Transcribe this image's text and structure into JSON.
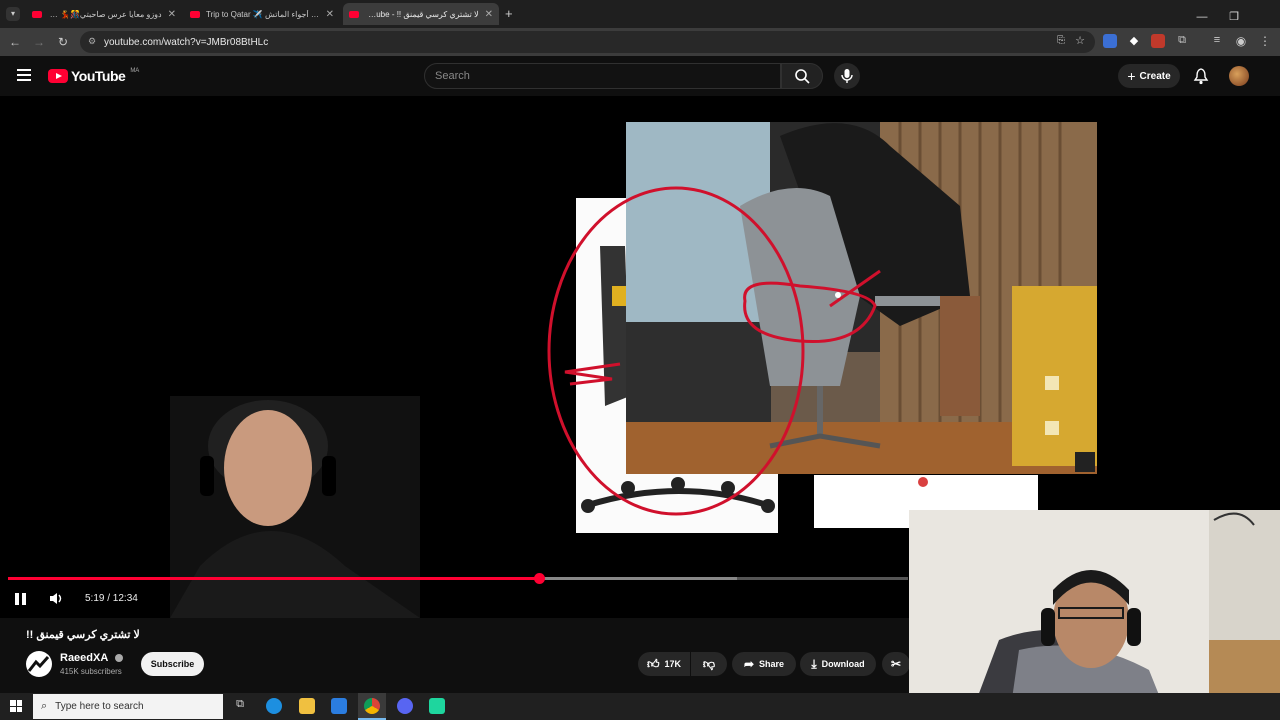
{
  "browser": {
    "tabs": [
      {
        "title": "دوزو معايا عرس صاحبتي🎊💃 جيب..."
      },
      {
        "title": "Trip to Qatar ✈️ أجواء الماتش 🇶🇦"
      },
      {
        "title": "لا تشتري كرسي قيمنق !! - YouTube"
      }
    ],
    "url": "youtube.com/watch?v=JMBr08BtHLc"
  },
  "youtube": {
    "logo_text": "YouTube",
    "region": "MA",
    "search_placeholder": "Search",
    "create_label": "Create"
  },
  "player": {
    "time_display": "5:19 / 12:34",
    "progress": 0.59,
    "buffered": 0.81
  },
  "video": {
    "title": "لا تشتري كرسي قيمنق !!",
    "channel": "RaeedXA",
    "subscribers": "415K subscribers",
    "subscribe_label": "Subscribe",
    "likes": "17K",
    "share_label": "Share",
    "download_label": "Download"
  },
  "taskbar": {
    "search_placeholder": "Type here to search"
  },
  "colors": {
    "accent": "#ff0033",
    "background": "#0f0f0f"
  }
}
